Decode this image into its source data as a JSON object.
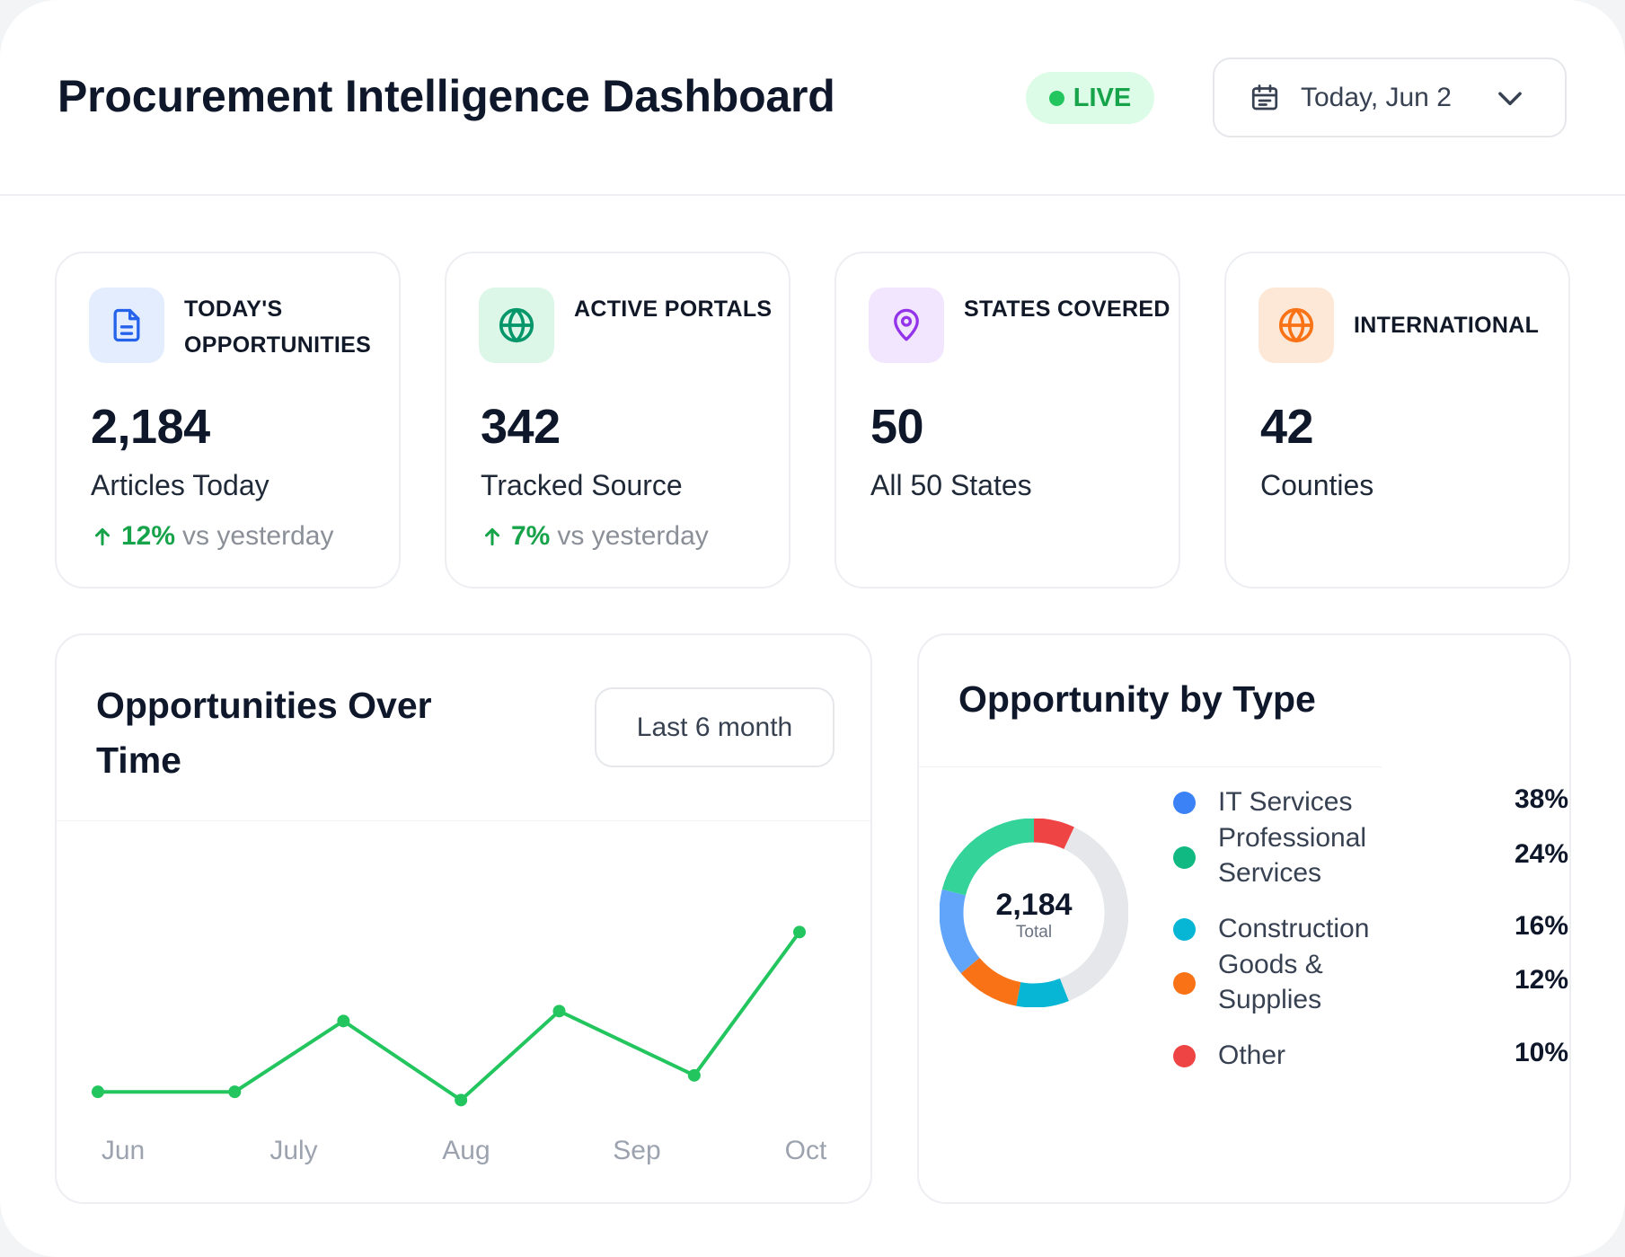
{
  "header": {
    "title": "Procurement Intelligence Dashboard",
    "live_label": "LIVE",
    "date_label": "Today, Jun 2"
  },
  "stats": [
    {
      "label": "TODAY'S OPPORTUNITIES",
      "value": "2,184",
      "sub": "Articles Today",
      "delta": "12%",
      "delta_text": "vs yesterday",
      "icon": "document-icon",
      "accent": "#2563eb",
      "tint": "#e3edfd"
    },
    {
      "label": "ACTIVE PORTALS",
      "value": "342",
      "sub": "Tracked Source",
      "delta": "7%",
      "delta_text": "vs yesterday",
      "icon": "globe-icon",
      "accent": "#059669",
      "tint": "#dcf6e8"
    },
    {
      "label": "STATES COVERED",
      "value": "50",
      "sub": "All 50 States",
      "icon": "map-pin-icon",
      "accent": "#9333ea",
      "tint": "#f1e6fd"
    },
    {
      "label": "INTERNATIONAL",
      "value": "42",
      "sub": "Counties",
      "icon": "globe-icon",
      "accent": "#f97316",
      "tint": "#fde8d7"
    }
  ],
  "line_chart": {
    "title": "Opportunities Over Time",
    "range_label": "Last 6 month"
  },
  "chart_data": [
    {
      "type": "line",
      "title": "Opportunities Over Time",
      "tick_labels": [
        "Jun",
        "July",
        "Aug",
        "Sep",
        "Oct"
      ],
      "series": [
        {
          "color": "#22c55e",
          "x": [
            0,
            0.78,
            1.4,
            2.07,
            2.63,
            3.4,
            4.0
          ],
          "y": [
            13,
            13,
            56,
            8,
            62,
            23,
            110
          ]
        }
      ],
      "ylim": [
        0,
        150
      ],
      "grid": false
    },
    {
      "type": "pie",
      "title": "Opportunity by Type",
      "total": "2,184",
      "total_label": "Total",
      "categories": [
        "IT Services",
        "Professional Services",
        "Construction",
        "Goods & Supplies",
        "Other"
      ],
      "values": [
        38,
        24,
        16,
        12,
        10
      ],
      "value_labels": [
        "38%",
        "24%",
        "16%",
        "12%",
        "10%"
      ],
      "colors": [
        "#3b82f6",
        "#10b981",
        "#06b6d4",
        "#f97316",
        "#ef4444"
      ],
      "segments": [
        {
          "color": "#ef4444",
          "from": 0.0,
          "to": 0.07
        },
        {
          "color": "#e5e7eb",
          "from": 0.07,
          "to": 0.44
        },
        {
          "color": "#06b6d4",
          "from": 0.44,
          "to": 0.53
        },
        {
          "color": "#f97316",
          "from": 0.53,
          "to": 0.64
        },
        {
          "color": "#60a5fa",
          "from": 0.64,
          "to": 0.79
        },
        {
          "color": "#34d399",
          "from": 0.79,
          "to": 1.0
        }
      ],
      "legend_position": "right"
    }
  ]
}
